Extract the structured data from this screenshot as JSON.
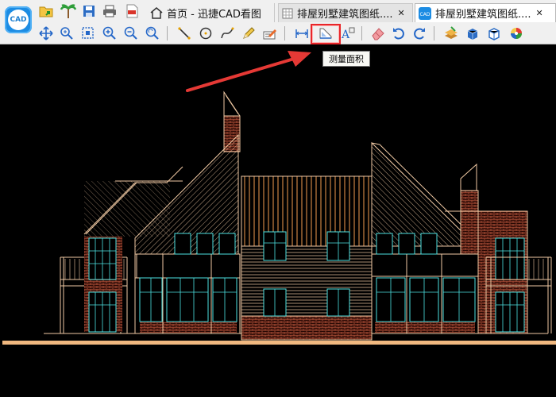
{
  "app": {
    "logo_text": "CAD"
  },
  "tabs": [
    {
      "label": "首页 - 迅捷CAD看图",
      "icon": "home-icon"
    },
    {
      "label": "排屋别墅建筑图纸....",
      "icon": "drawing-doc-icon"
    },
    {
      "label": "排屋别墅建筑图纸....",
      "icon": "cad-doc-icon",
      "active": true
    }
  ],
  "tab_close_glyph": "✕",
  "quick_access": [
    "open-folder-icon",
    "palm-tree-icon",
    "save-icon",
    "print-icon",
    "pdf-export-icon"
  ],
  "toolbar": {
    "groups": [
      [
        "pan-icon",
        "zoom-window-icon",
        "zoom-extents-icon",
        "zoom-in-icon",
        "zoom-out-icon",
        "zoom-previous-icon"
      ],
      [
        "line-icon",
        "circle-icon",
        "spline-icon",
        "pencil-icon",
        "text-edit-icon"
      ],
      [
        "measure-distance-icon",
        "measure-area-icon",
        "text-annotation-icon"
      ],
      [
        "eraser-icon",
        "undo-icon",
        "redo-icon"
      ],
      [
        "layers-icon",
        "3d-box-icon",
        "3d-view-icon",
        "color-wheel-icon"
      ]
    ]
  },
  "tooltip": {
    "text": "测量面积"
  },
  "colors": {
    "highlight": "#e8262a",
    "arrow": "#e53935",
    "drawing_line": "#f0c9a3",
    "drawing_brick": "#e06a4a",
    "drawing_window": "#4de0e0",
    "drawing_roof": "#f29b4f",
    "background": "#000000"
  }
}
